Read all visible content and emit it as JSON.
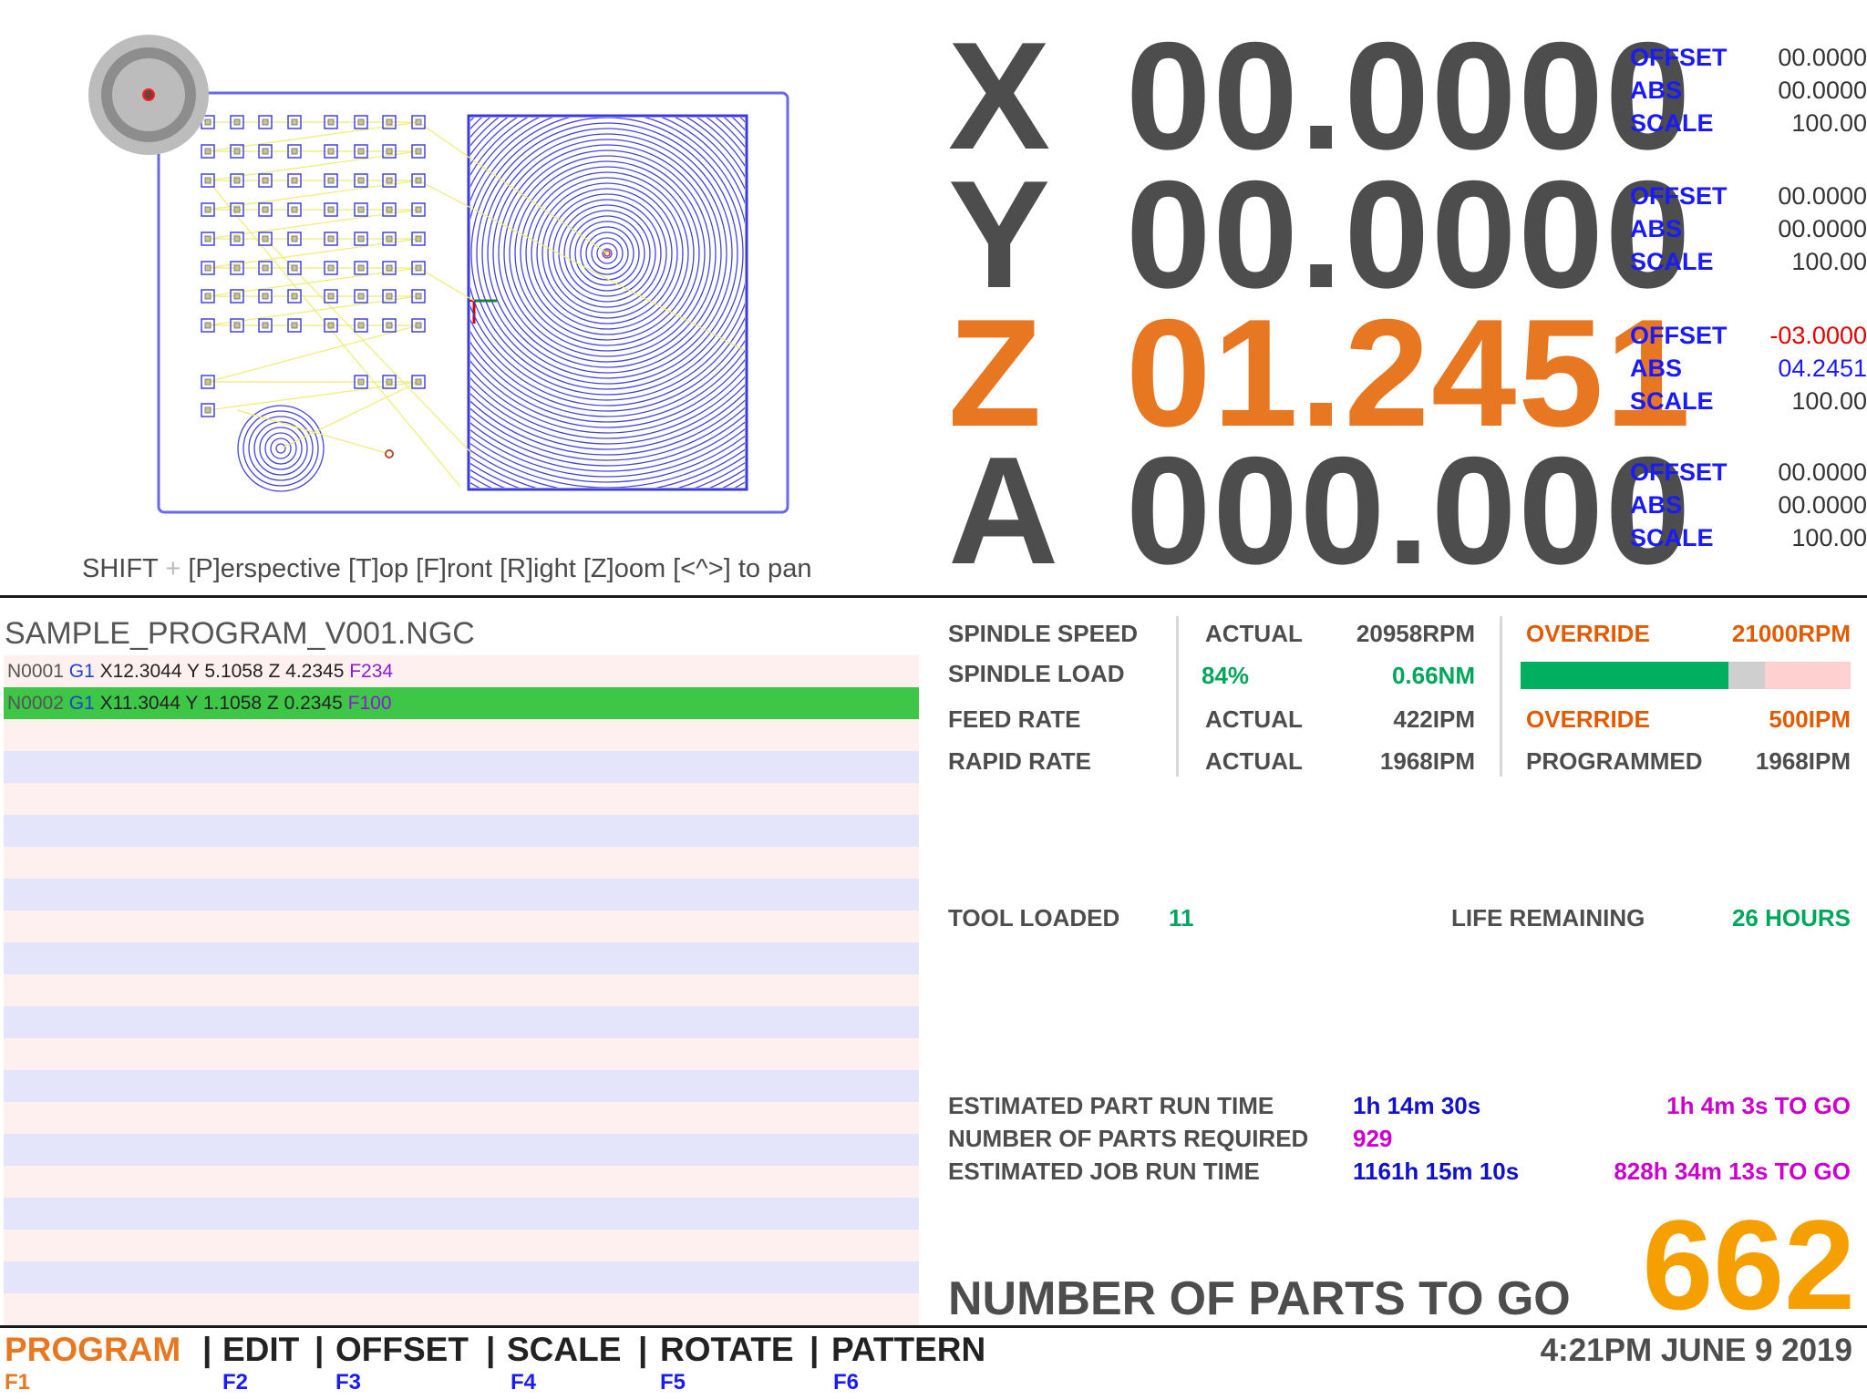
{
  "viewport": {
    "hint_prefix": "SHIFT",
    "hint_plus": "+",
    "hint_keys": "[P]erspective [T]op [F]ront [R]ight [Z]oom [<^>] to pan"
  },
  "dro": {
    "axes": [
      {
        "letter": "X",
        "value": "00.0000",
        "offset": "00.0000",
        "abs": "00.0000",
        "scale": "100.00"
      },
      {
        "letter": "Y",
        "value": "00.0000",
        "offset": "00.0000",
        "abs": "00.0000",
        "scale": "100.00"
      },
      {
        "letter": "Z",
        "value": "01.2451",
        "offset": "-03.0000",
        "abs": "04.2451",
        "scale": "100.00"
      },
      {
        "letter": "A",
        "value": "000.000",
        "offset": "00.0000",
        "abs": "00.0000",
        "scale": "100.00"
      }
    ],
    "labels": {
      "offset": "OFFSET",
      "abs": "ABS",
      "scale": "SCALE"
    },
    "active_axis": "Z",
    "colors": {
      "normal": "#4d4d4d",
      "active": "#e87722",
      "label": "#1a1aff",
      "negative": "#e00000"
    }
  },
  "program": {
    "filename": "SAMPLE_PROGRAM_V001.NGC",
    "lines": [
      {
        "n": "N0001",
        "g": "G1",
        "coords": "X12.3044 Y 5.1058 Z 4.2345",
        "f": "F234"
      },
      {
        "n": "N0002",
        "g": "G1",
        "coords": "X11.3044 Y 1.1058 Z 0.2345",
        "f": "F100"
      }
    ],
    "current_line": 1
  },
  "status": {
    "spindle_speed": {
      "label": "SPINDLE SPEED",
      "actual_label": "ACTUAL",
      "actual": "20958RPM",
      "override_label": "OVERRIDE",
      "override": "21000RPM"
    },
    "spindle_load": {
      "label": "SPINDLE LOAD",
      "percent": "84%",
      "torque": "0.66NM",
      "load_fraction": 0.63,
      "mark_fraction": 0.74
    },
    "feed_rate": {
      "label": "FEED RATE",
      "actual_label": "ACTUAL",
      "actual": "422IPM",
      "override_label": "OVERRIDE",
      "override": "500IPM"
    },
    "rapid_rate": {
      "label": "RAPID RATE",
      "actual_label": "ACTUAL",
      "actual": "1968IPM",
      "programmed_label": "PROGRAMMED",
      "programmed": "1968IPM"
    }
  },
  "tool": {
    "loaded_label": "TOOL LOADED",
    "loaded": "11",
    "life_label": "LIFE REMAINING",
    "life": "26 HOURS"
  },
  "job": {
    "part_time_label": "ESTIMATED PART RUN TIME",
    "part_time": "1h 14m 30s",
    "part_togo": "1h 4m 3s TO GO",
    "parts_req_label": "NUMBER OF PARTS REQUIRED",
    "parts_req": "929",
    "job_time_label": "ESTIMATED JOB RUN TIME",
    "job_time": "1161h 15m 10s",
    "job_togo": "828h 34m 13s TO GO",
    "parts_togo_label": "NUMBER OF PARTS TO GO",
    "parts_togo": "662"
  },
  "nav": {
    "items": [
      {
        "label": "PROGRAM",
        "key": "F1"
      },
      {
        "label": "EDIT",
        "key": "F2"
      },
      {
        "label": "OFFSET",
        "key": "F3"
      },
      {
        "label": "SCALE",
        "key": "F4"
      },
      {
        "label": "ROTATE",
        "key": "F5"
      },
      {
        "label": "PATTERN",
        "key": "F6"
      }
    ],
    "separator": "|",
    "active": "PROGRAM"
  },
  "clock": "4:21PM JUNE 9 2019"
}
